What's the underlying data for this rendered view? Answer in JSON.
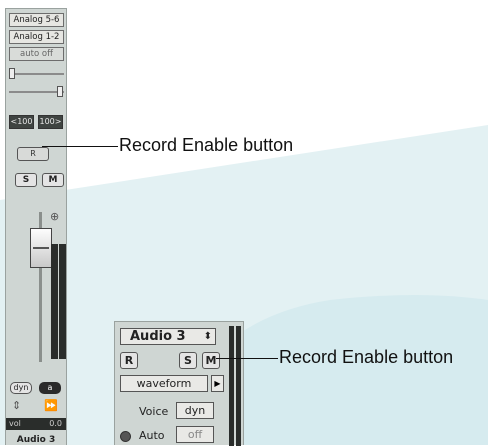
{
  "strip": {
    "insert_1": "Analog 5-6",
    "insert_2": "Analog 1-2",
    "automation": "auto off",
    "pan_left": "<100",
    "pan_right": "100>",
    "record_label": "R",
    "solo_label": "S",
    "mute_label": "M",
    "dyn_label": "dyn",
    "auto_badge": "a",
    "vol_label": "vol",
    "vol_value": "0.0",
    "track_name": "Audio 3"
  },
  "mixer_strip": {
    "track_name": "Audio 3",
    "record_label": "R",
    "solo_label": "S",
    "mute_label": "M",
    "view_label": "waveform",
    "voice_label": "Voice",
    "voice_value": "dyn",
    "auto_label": "Auto",
    "auto_value": "off"
  },
  "callouts": {
    "top": "Record Enable button",
    "bottom": "Record Enable button"
  },
  "colors": {
    "strip_bg": "#cfd6d3",
    "decor_teal": "#e3f1f3"
  }
}
